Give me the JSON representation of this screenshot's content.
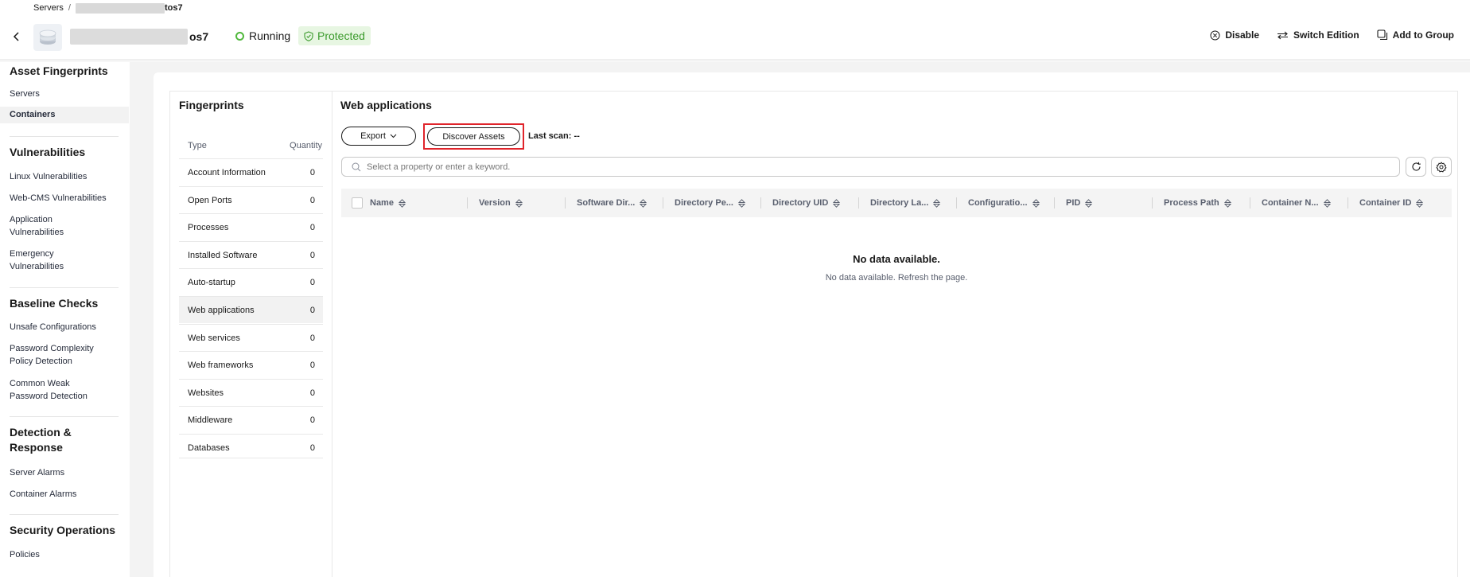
{
  "breadcrumb": {
    "root": "Servers",
    "separator": "/",
    "tail": "tos7"
  },
  "header": {
    "server_name_tail": "os7",
    "status": "Running",
    "badge": "Protected",
    "actions": {
      "disable": "Disable",
      "switch_edition": "Switch Edition",
      "add_to_group": "Add to Group"
    }
  },
  "sidebar": {
    "sections": [
      {
        "title": "Asset Fingerprints",
        "items": [
          "Servers",
          "Containers"
        ]
      },
      {
        "title": "Vulnerabilities",
        "items": [
          "Linux Vulnerabilities",
          "Web-CMS Vulnerabilities",
          "Application Vulnerabilities",
          "Emergency Vulnerabilities"
        ]
      },
      {
        "title": "Baseline Checks",
        "items": [
          "Unsafe Configurations",
          "Password Complexity Policy Detection",
          "Common Weak Password Detection"
        ]
      },
      {
        "title": "Detection & Response",
        "items": [
          "Server Alarms",
          "Container Alarms"
        ]
      },
      {
        "title": "Security Operations",
        "items": [
          "Policies"
        ]
      }
    ],
    "active_item": "Containers"
  },
  "fingerprints": {
    "title": "Fingerprints",
    "col_type": "Type",
    "col_quantity": "Quantity",
    "rows": [
      {
        "label": "Account Information",
        "value": "0"
      },
      {
        "label": "Open Ports",
        "value": "0"
      },
      {
        "label": "Processes",
        "value": "0"
      },
      {
        "label": "Installed Software",
        "value": "0"
      },
      {
        "label": "Auto-startup",
        "value": "0"
      },
      {
        "label": "Web applications",
        "value": "0"
      },
      {
        "label": "Web services",
        "value": "0"
      },
      {
        "label": "Web frameworks",
        "value": "0"
      },
      {
        "label": "Websites",
        "value": "0"
      },
      {
        "label": "Middleware",
        "value": "0"
      },
      {
        "label": "Databases",
        "value": "0"
      }
    ],
    "active_row": "Web applications"
  },
  "web_apps": {
    "title": "Web applications",
    "export_label": "Export",
    "discover_label": "Discover Assets",
    "last_scan": "Last scan: --",
    "search_placeholder": "Select a property or enter a keyword.",
    "columns": [
      "Name",
      "Version",
      "Software Dir...",
      "Directory Pe...",
      "Directory UID",
      "Directory La...",
      "Configuratio...",
      "PID",
      "Process Path",
      "Container N...",
      "Container ID"
    ],
    "empty_title": "No data available.",
    "empty_sub": "No data available. Refresh the page."
  }
}
